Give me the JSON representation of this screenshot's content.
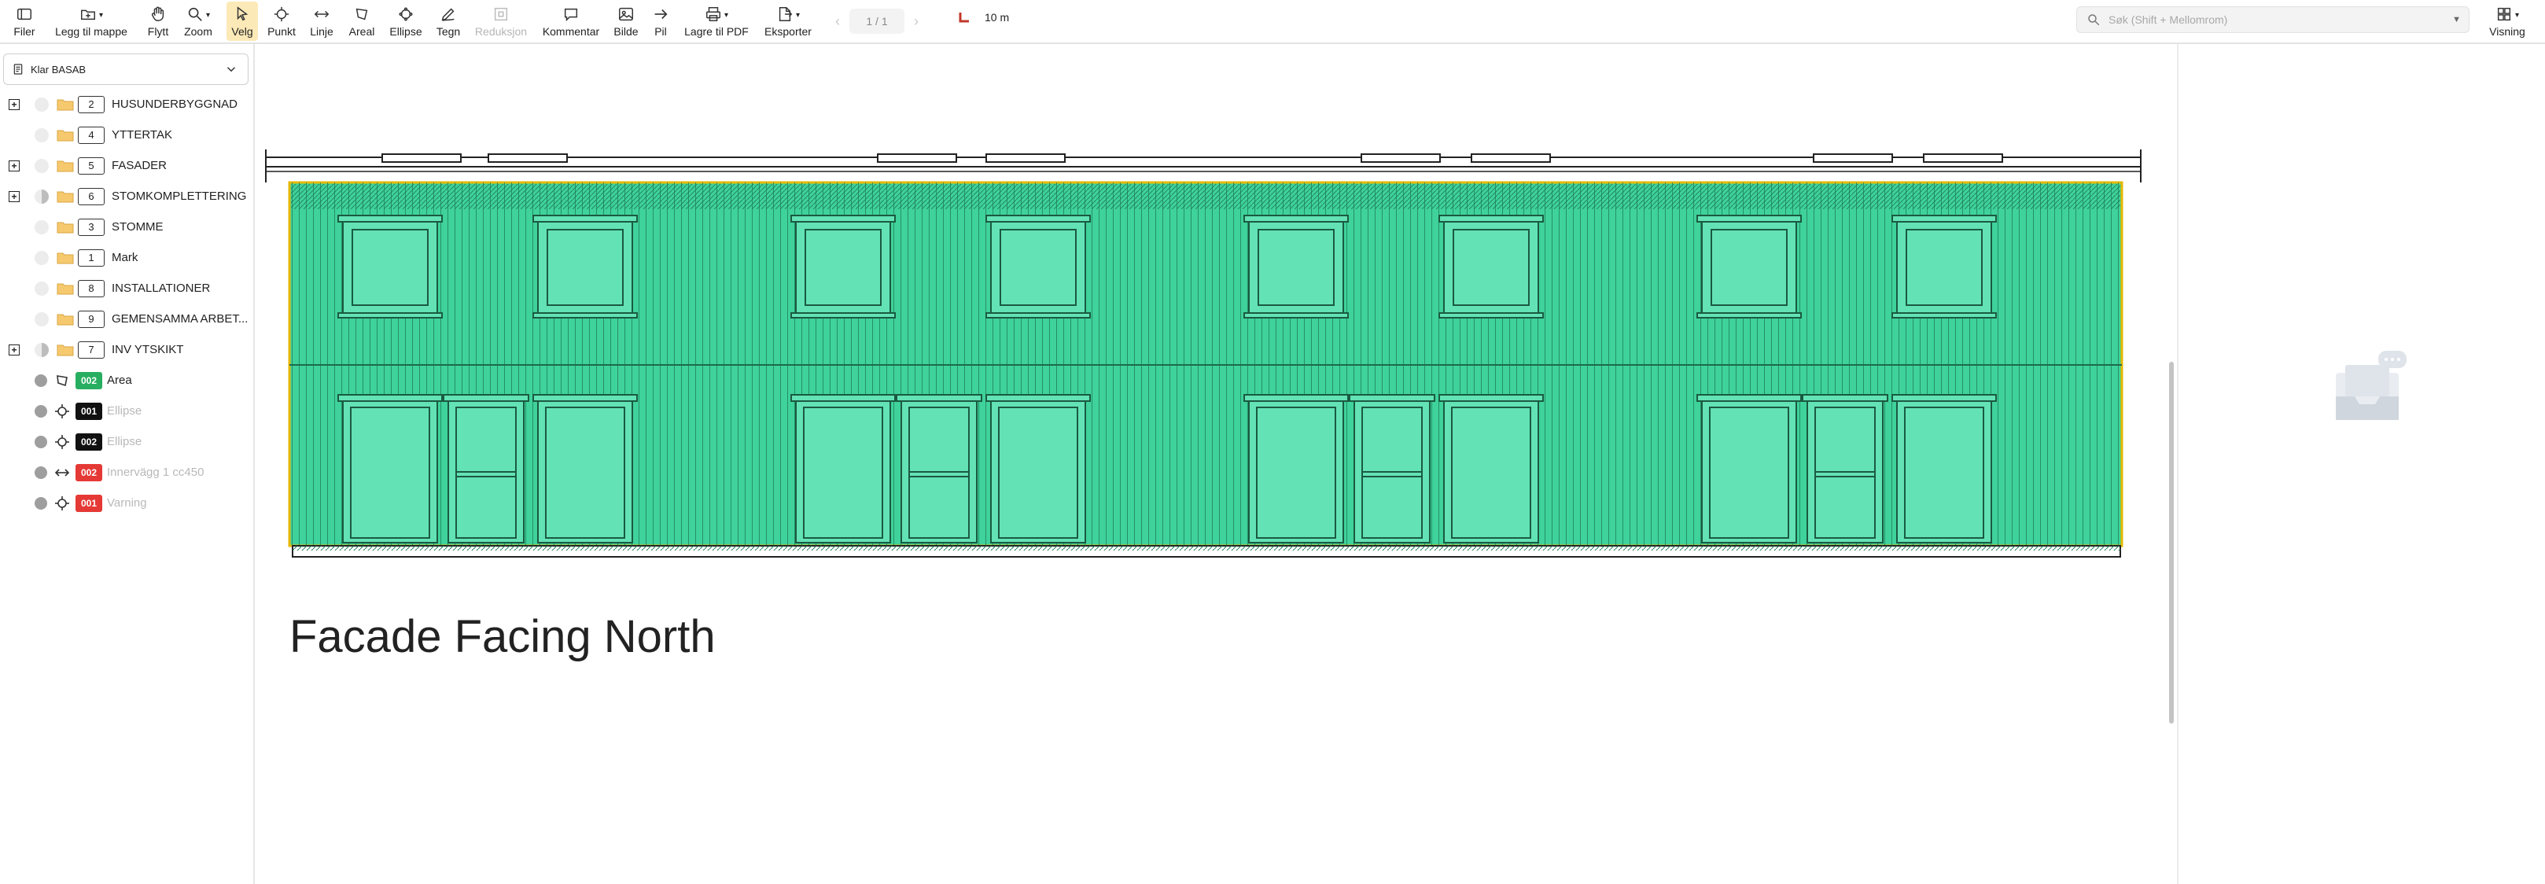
{
  "toolbar": {
    "file": "Filer",
    "add_to_folder": "Legg til mappe",
    "move": "Flytt",
    "zoom": "Zoom",
    "select": "Velg",
    "point": "Punkt",
    "line": "Linje",
    "area": "Areal",
    "ellipse": "Ellipse",
    "draw": "Tegn",
    "reduction": "Reduksjon",
    "comment": "Kommentar",
    "image": "Bilde",
    "arrow": "Pil",
    "save_pdf": "Lagre til PDF",
    "export": "Eksporter",
    "page_indicator": "1 / 1",
    "scale_label": "10 m",
    "view": "Visning"
  },
  "search": {
    "placeholder": "Søk (Shift + Mellomrom)"
  },
  "sidebar": {
    "project": "Klar BASAB",
    "layers": [
      {
        "num": "2",
        "name": "HUSUNDERBYGGNAD",
        "expandable": true
      },
      {
        "num": "4",
        "name": "YTTERTAK",
        "expandable": false
      },
      {
        "num": "5",
        "name": "FASADER",
        "expandable": true
      },
      {
        "num": "6",
        "name": "STOMKOMPLETTERING",
        "expandable": true
      },
      {
        "num": "3",
        "name": "STOMME",
        "expandable": false
      },
      {
        "num": "1",
        "name": "Mark",
        "expandable": false
      },
      {
        "num": "8",
        "name": "INSTALLATIONER",
        "expandable": false
      },
      {
        "num": "9",
        "name": "GEMENSAMMA ARBET...",
        "expandable": false
      },
      {
        "num": "7",
        "name": "INV YTSKIKT",
        "expandable": true
      }
    ],
    "objects": [
      {
        "code": "002",
        "name": "Area",
        "color": "#27ae60",
        "icon": "area-icon",
        "dim": false
      },
      {
        "code": "001",
        "name": "Ellipse",
        "color": "#111111",
        "icon": "ellipse-icon",
        "dim": true
      },
      {
        "code": "002",
        "name": "Ellipse",
        "color": "#111111",
        "icon": "ellipse-icon",
        "dim": true
      },
      {
        "code": "002",
        "name": "Innervägg 1 cc450",
        "color": "#e53935",
        "icon": "line-icon",
        "dim": true
      },
      {
        "code": "001",
        "name": "Varning",
        "color": "#e53935",
        "icon": "ellipse-icon",
        "dim": true
      }
    ]
  },
  "drawing": {
    "title": "Facade Facing North",
    "fill_color": "#3fd29b",
    "outline_color": "#e6b800"
  },
  "colors": {
    "active_tool_bg": "#fbe9b7",
    "scale_marker": "#c0392b"
  }
}
